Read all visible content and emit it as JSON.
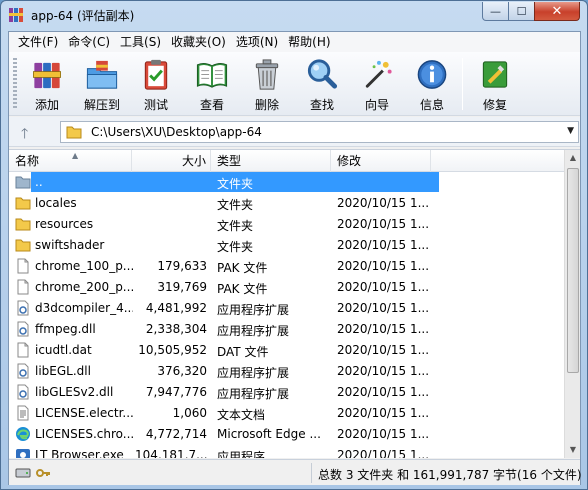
{
  "window": {
    "title": "app-64 (评估副本)",
    "minimize_glyph": "—",
    "maximize_glyph": "☐",
    "close_glyph": "✕"
  },
  "menu": [
    "文件(F)",
    "命令(C)",
    "工具(S)",
    "收藏夹(O)",
    "选项(N)",
    "帮助(H)"
  ],
  "toolbar": {
    "buttons": [
      {
        "label": "添加",
        "icon": "add-archive-icon"
      },
      {
        "label": "解压到",
        "icon": "extract-icon"
      },
      {
        "label": "测试",
        "icon": "test-icon"
      },
      {
        "label": "查看",
        "icon": "view-icon"
      },
      {
        "label": "删除",
        "icon": "delete-icon"
      },
      {
        "label": "查找",
        "icon": "find-icon"
      },
      {
        "label": "向导",
        "icon": "wizard-icon"
      },
      {
        "label": "信息",
        "icon": "info-icon"
      },
      {
        "label": "修复",
        "icon": "repair-icon"
      }
    ]
  },
  "address": {
    "up_glyph": "🡑",
    "path": "C:\\Users\\XU\\Desktop\\app-64",
    "dropdown_glyph": "▼"
  },
  "list": {
    "columns": {
      "name": "名称",
      "size": "大小",
      "type": "类型",
      "modified": "修改"
    },
    "sort_glyph": "▲",
    "rows": [
      {
        "name": "..",
        "size": "",
        "type": "文件夹",
        "modified": "",
        "icon": "folder-up-icon",
        "selected": true
      },
      {
        "name": "locales",
        "size": "",
        "type": "文件夹",
        "modified": "2020/10/15 1...",
        "icon": "folder-icon"
      },
      {
        "name": "resources",
        "size": "",
        "type": "文件夹",
        "modified": "2020/10/15 1...",
        "icon": "folder-icon"
      },
      {
        "name": "swiftshader",
        "size": "",
        "type": "文件夹",
        "modified": "2020/10/15 1...",
        "icon": "folder-icon"
      },
      {
        "name": "chrome_100_p...",
        "size": "179,633",
        "type": "PAK 文件",
        "modified": "2020/10/15 1...",
        "icon": "file-icon"
      },
      {
        "name": "chrome_200_p...",
        "size": "319,769",
        "type": "PAK 文件",
        "modified": "2020/10/15 1...",
        "icon": "file-icon"
      },
      {
        "name": "d3dcompiler_4...",
        "size": "4,481,992",
        "type": "应用程序扩展",
        "modified": "2020/10/15 1...",
        "icon": "dll-icon"
      },
      {
        "name": "ffmpeg.dll",
        "size": "2,338,304",
        "type": "应用程序扩展",
        "modified": "2020/10/15 1...",
        "icon": "dll-icon"
      },
      {
        "name": "icudtl.dat",
        "size": "10,505,952",
        "type": "DAT 文件",
        "modified": "2020/10/15 1...",
        "icon": "file-icon"
      },
      {
        "name": "libEGL.dll",
        "size": "376,320",
        "type": "应用程序扩展",
        "modified": "2020/10/15 1...",
        "icon": "dll-icon"
      },
      {
        "name": "libGLESv2.dll",
        "size": "7,947,776",
        "type": "应用程序扩展",
        "modified": "2020/10/15 1...",
        "icon": "dll-icon"
      },
      {
        "name": "LICENSE.electr...",
        "size": "1,060",
        "type": "文本文档",
        "modified": "2020/10/15 1...",
        "icon": "text-file-icon"
      },
      {
        "name": "LICENSES.chro...",
        "size": "4,772,714",
        "type": "Microsoft Edge ...",
        "modified": "2020/10/15 1...",
        "icon": "edge-icon"
      },
      {
        "name": "LT Browser.exe",
        "size": "104,181,7...",
        "type": "应用程序",
        "modified": "2020/10/15 1...",
        "icon": "exe-icon"
      }
    ]
  },
  "scrollbar": {
    "up_glyph": "▲",
    "down_glyph": "▼"
  },
  "status": {
    "summary": "总数 3 文件夹 和 161,991,787 字节(16 个文件)"
  },
  "colors": {
    "selection": "#3399ff",
    "folder": "#f3c94a",
    "title_gradient_top": "#c6dbf1"
  }
}
